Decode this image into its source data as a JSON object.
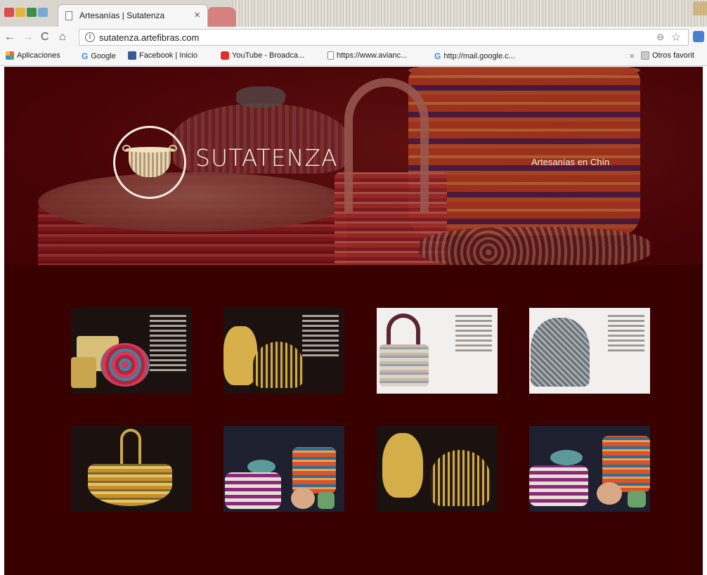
{
  "browser": {
    "tab_title": "Artesanías | Sutatenza",
    "tab_close": "×",
    "url": "sutatenza.artefibras.com",
    "info_glyph": "i",
    "nav": {
      "back": "←",
      "forward": "→",
      "reload": "C",
      "home": "⌂"
    },
    "zoom_glyph": "⊖",
    "star_glyph": "☆",
    "bookmarks": [
      {
        "icon": "apps-icon",
        "label": "Aplicaciones"
      },
      {
        "icon": "google-icon",
        "label": "Google"
      },
      {
        "icon": "facebook-icon",
        "label": "Facebook | Inicio"
      },
      {
        "icon": "youtube-icon",
        "label": "YouTube - Broadca..."
      },
      {
        "icon": "page-icon",
        "label": "https://www.avianc..."
      },
      {
        "icon": "google-icon",
        "label": "http://mail.google.c..."
      }
    ],
    "more_bookmarks": "»",
    "other_bookmarks": "Otros favorit"
  },
  "hero": {
    "brand": "SUTATENZA",
    "tagline": "Artesanías en Chín"
  },
  "gallery": {
    "items": [
      {
        "name": "thumb-basket-set-tray",
        "style": "dark"
      },
      {
        "name": "thumb-vase-and-lidded-basket",
        "style": "dark"
      },
      {
        "name": "thumb-handbag",
        "style": "light"
      },
      {
        "name": "thumb-dome-basket",
        "style": "light"
      },
      {
        "name": "thumb-handled-basket",
        "style": "dark"
      },
      {
        "name": "thumb-striped-basket-set",
        "style": "dark"
      },
      {
        "name": "thumb-vase-and-lidded-basket-2",
        "style": "dark"
      },
      {
        "name": "thumb-striped-basket-set-2",
        "style": "dark"
      }
    ]
  },
  "colors": {
    "page_bg": "#390000",
    "hero_bg": "#4c0709",
    "brand_text": "#f6eee6"
  }
}
